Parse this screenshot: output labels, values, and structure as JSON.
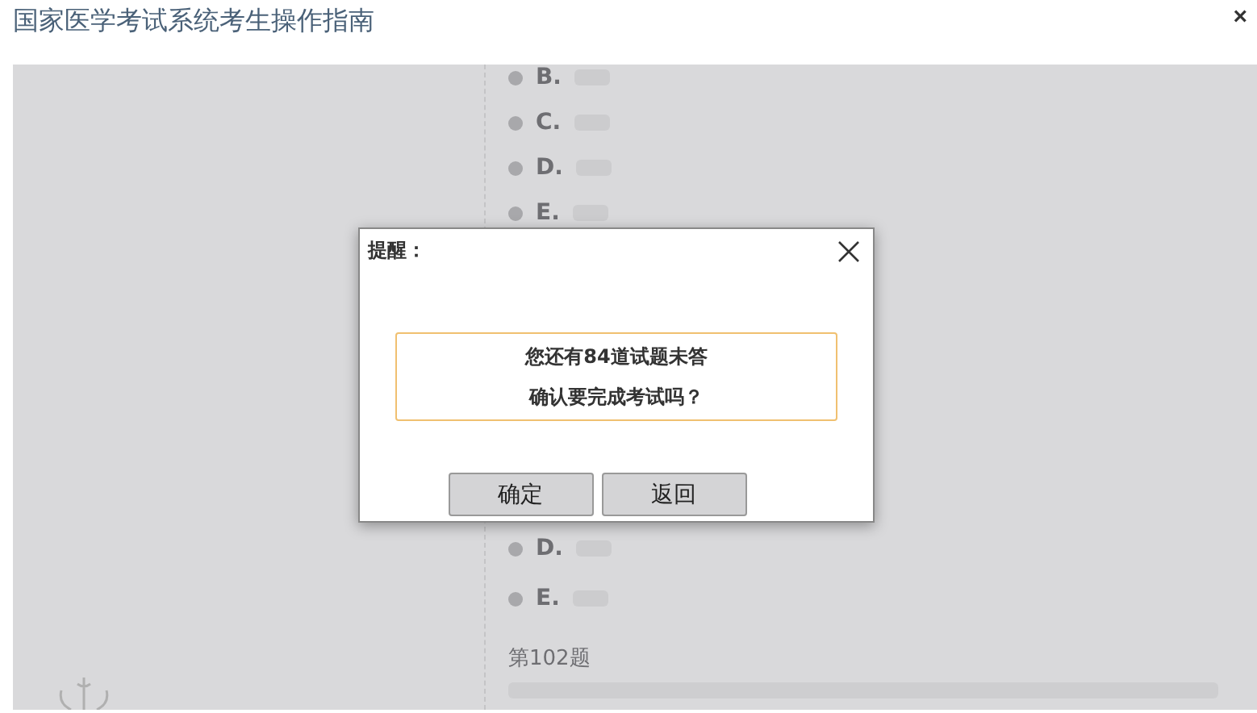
{
  "window": {
    "title": "国家医学考试系统考生操作指南",
    "close": "×"
  },
  "background": {
    "options_top": [
      {
        "letter": "B."
      },
      {
        "letter": "C."
      },
      {
        "letter": "D."
      },
      {
        "letter": "E."
      }
    ],
    "options_bottom": [
      {
        "letter": "D."
      },
      {
        "letter": "E."
      }
    ],
    "question_number": "第102题"
  },
  "dialog": {
    "title": "提醒：",
    "lines": [
      "您还有**84**道试题未答",
      "确认要完成考试吗？"
    ],
    "buttons": [
      "确定",
      "返回"
    ]
  }
}
